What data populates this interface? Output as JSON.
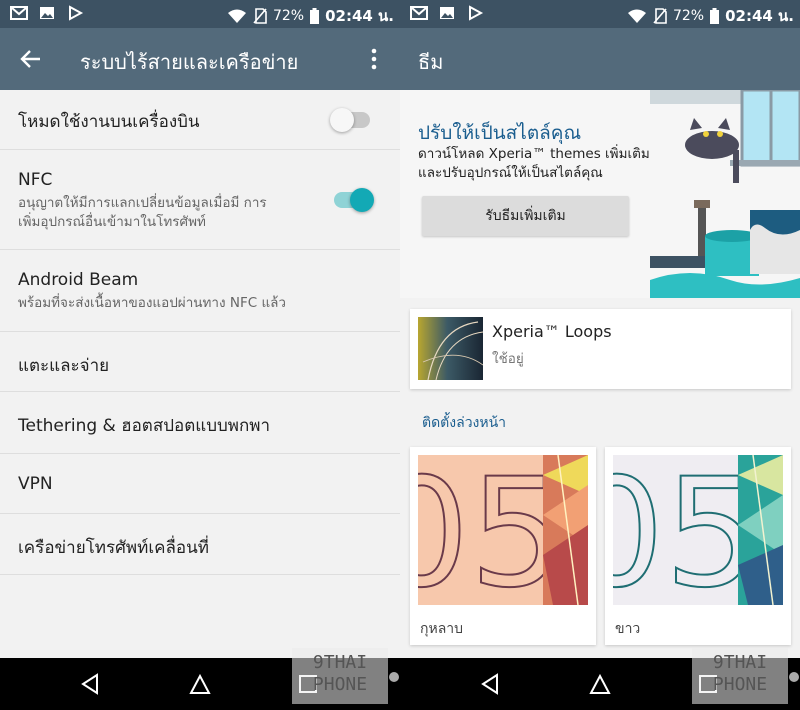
{
  "status_bar": {
    "battery": "72%",
    "time": "02:44 น."
  },
  "left": {
    "toolbar_title": "ระบบไร้สายและเครือข่าย",
    "items": [
      {
        "title": "โหมดใช้งานบนเครื่องบิน",
        "toggle": false
      },
      {
        "title": "NFC",
        "subtitle": "อนุญาตให้มีการแลกเปลี่ยนข้อมูลเมื่อมี การเพิ่มอุปกรณ์อื่นเข้ามาในโทรศัพท์",
        "toggle": true
      },
      {
        "title": "Android Beam",
        "subtitle": "พร้อมที่จะส่งเนื้อหาของแอปผ่านทาง NFC แล้ว"
      },
      {
        "title": "แตะและจ่าย"
      },
      {
        "title": "Tethering & ฮอตสปอตแบบพกพา"
      },
      {
        "title": "VPN"
      },
      {
        "title": "เครือข่ายโทรศัพท์เคลื่อนที่"
      }
    ]
  },
  "right": {
    "toolbar_title": "ธีม",
    "hero": {
      "title": "ปรับให้เป็นสไตล์คุณ",
      "description": "ดาวน์โหลด Xperia™ themes เพิ่มเติม และปรับอุปกรณ์ให้เป็นสไตล์คุณ",
      "button": "รับธีมเพิ่มเติม"
    },
    "current_theme": {
      "name": "Xperia™ Loops",
      "status": "ใช้อยู่"
    },
    "preinstalled_label": "ติดตั้งล่วงหน้า",
    "themes": [
      {
        "name": "กุหลาบ",
        "preview_text": "05"
      },
      {
        "name": "ขาว",
        "preview_text": "05"
      }
    ]
  },
  "watermark": {
    "line1": "9THAI",
    "line2": "PHONE"
  },
  "colors": {
    "statusbar": "#3d5263",
    "toolbar": "#536a7b",
    "accent": "#13a9b5",
    "link": "#1b5e8f"
  }
}
